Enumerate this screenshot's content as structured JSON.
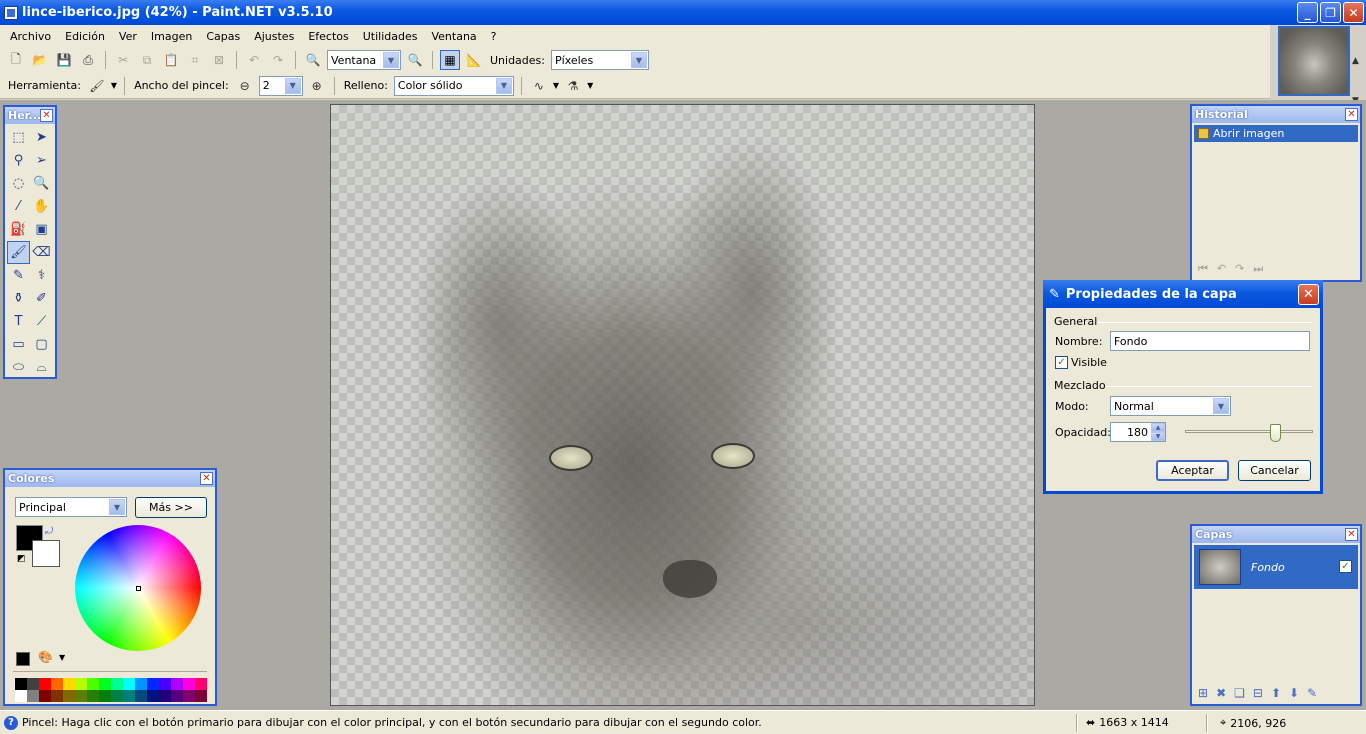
{
  "window": {
    "title": "lince-iberico.jpg (42%) - Paint.NET v3.5.10"
  },
  "menu": [
    "Archivo",
    "Edición",
    "Ver",
    "Imagen",
    "Capas",
    "Ajustes",
    "Efectos",
    "Utilidades",
    "Ventana",
    "?"
  ],
  "toolbar": {
    "zoom_value": "Ventana",
    "units_label": "Unidades:",
    "units_value": "Píxeles",
    "tool_label": "Herramienta:",
    "brush_width_label": "Ancho del pincel:",
    "brush_width_value": "2",
    "fill_label": "Relleno:",
    "fill_value": "Color sólido"
  },
  "tools_window": {
    "title": "Her..."
  },
  "colors_window": {
    "title": "Colores",
    "mode_value": "Principal",
    "more_button": "Más >>",
    "primary_color": "#000000",
    "secondary_color": "#ffffff",
    "palette": [
      "#000000",
      "#404040",
      "#ff0000",
      "#ff6a00",
      "#ffd800",
      "#b6ff00",
      "#4cff00",
      "#00ff21",
      "#00ff90",
      "#00ffff",
      "#0094ff",
      "#0026ff",
      "#4800ff",
      "#b200ff",
      "#ff00dc",
      "#ff006e",
      "#ffffff",
      "#808080",
      "#7f0000",
      "#7f3300",
      "#7f6a00",
      "#5b7f00",
      "#267f00",
      "#007f0e",
      "#007f46",
      "#007f7f",
      "#004a7f",
      "#00137f",
      "#21007f",
      "#57007f",
      "#7f006e",
      "#7f0037"
    ]
  },
  "history_window": {
    "title": "Historial",
    "items": [
      "Abrir imagen"
    ]
  },
  "layers_window": {
    "title": "Capas",
    "layers": [
      {
        "name": "Fondo",
        "visible": true
      }
    ]
  },
  "dialog": {
    "title": "Propiedades de la capa",
    "general_label": "General",
    "name_label": "Nombre:",
    "name_value": "Fondo",
    "visible_label": "Visible",
    "visible_checked": true,
    "blend_label": "Mezclado",
    "mode_label": "Modo:",
    "mode_value": "Normal",
    "opacity_label": "Opacidad:",
    "opacity_value": "180",
    "opacity_fraction": 0.706,
    "accept_button": "Aceptar",
    "cancel_button": "Cancelar"
  },
  "statusbar": {
    "help_text": "Pincel: Haga clic con el botón primario para dibujar con el color principal, y con el botón secundario para dibujar con el segundo color.",
    "image_size": "1663 x 1414",
    "cursor_position": "2106, 926"
  }
}
